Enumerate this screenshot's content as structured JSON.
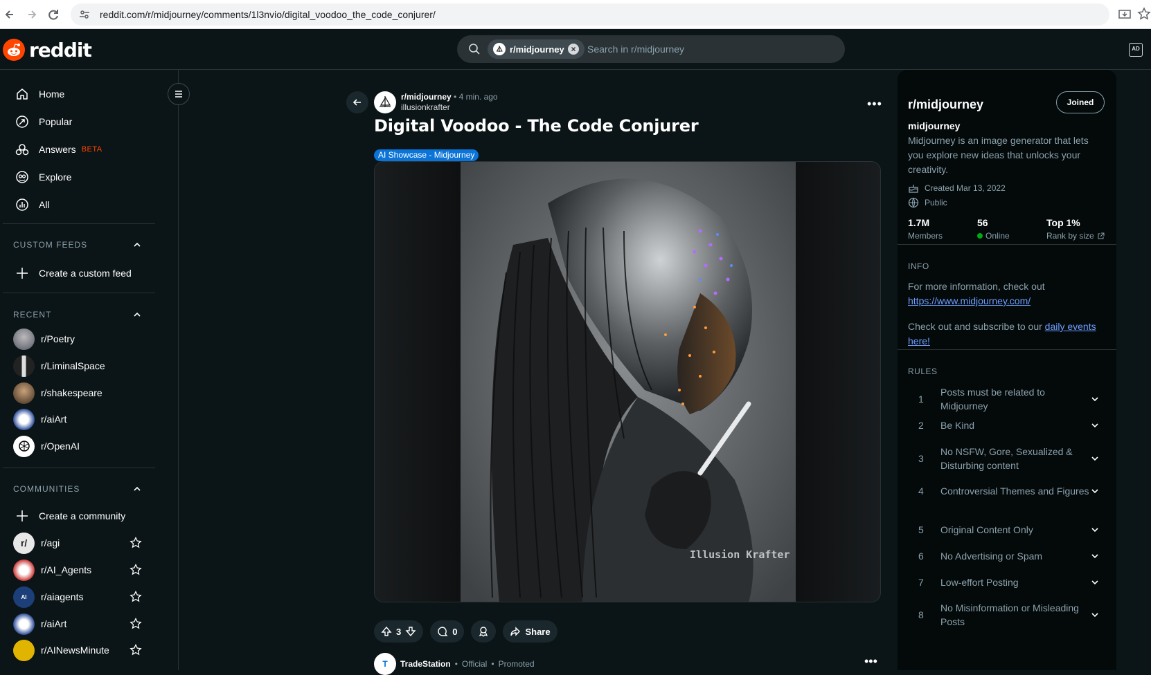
{
  "browser": {
    "url": "reddit.com/r/midjourney/comments/1l3nvio/digital_voodoo_the_code_conjurer/"
  },
  "header": {
    "logo_text": "reddit",
    "search_chip": "r/midjourney",
    "search_placeholder": "Search in r/midjourney"
  },
  "sidebar": {
    "nav": [
      {
        "label": "Home",
        "icon": "home-icon"
      },
      {
        "label": "Popular",
        "icon": "popular-icon"
      },
      {
        "label": "Answers",
        "icon": "answers-icon",
        "badge": "BETA"
      },
      {
        "label": "Explore",
        "icon": "explore-icon"
      },
      {
        "label": "All",
        "icon": "all-icon"
      }
    ],
    "custom_feeds": {
      "heading": "CUSTOM FEEDS",
      "create": "Create a custom feed"
    },
    "recent": {
      "heading": "RECENT",
      "items": [
        "r/Poetry",
        "r/LiminalSpace",
        "r/shakespeare",
        "r/aiArt",
        "r/OpenAI"
      ]
    },
    "communities": {
      "heading": "COMMUNITIES",
      "create": "Create a community",
      "items": [
        "r/agi",
        "r/AI_Agents",
        "r/aiagents",
        "r/aiArt",
        "r/AINewsMinute"
      ]
    }
  },
  "post": {
    "subreddit": "r/midjourney",
    "time": "4 min. ago",
    "author": "illusionkrafter",
    "title": "Digital Voodoo - The Code Conjurer",
    "flair": "AI Showcase - Midjourney",
    "watermark": "Illusion Krafter",
    "votes": "3",
    "comments": "0",
    "share": "Share"
  },
  "promoted": {
    "name": "TradeStation",
    "official": "Official",
    "promoted": "Promoted"
  },
  "right_sidebar": {
    "title": "r/midjourney",
    "join_button": "Joined",
    "name": "midjourney",
    "description": "Midjourney is an image generator that lets you explore new ideas that unlocks your creativity.",
    "created": "Created Mar 13, 2022",
    "visibility": "Public",
    "stats": [
      {
        "value": "1.7M",
        "label": "Members"
      },
      {
        "value": "56",
        "label": "Online"
      },
      {
        "value": "Top 1%",
        "label": "Rank by size"
      }
    ],
    "info_heading": "INFO",
    "info_text_1": "For more information, check out",
    "info_link": "https://www.midjourney.com/",
    "info_text_2": "Check out and subscribe to our",
    "info_link_2": "daily events here!",
    "rules_heading": "RULES",
    "rules": [
      {
        "n": "1",
        "text": "Posts must be related to Midjourney"
      },
      {
        "n": "2",
        "text": "Be Kind"
      },
      {
        "n": "3",
        "text": "No NSFW, Gore, Sexualized & Disturbing content"
      },
      {
        "n": "4",
        "text": "Controversial Themes and Figures"
      },
      {
        "n": "5",
        "text": "Original Content Only"
      },
      {
        "n": "6",
        "text": "No Advertising or Spam"
      },
      {
        "n": "7",
        "text": "Low-effort Posting"
      },
      {
        "n": "8",
        "text": "No Misinformation or Misleading Posts"
      }
    ]
  }
}
